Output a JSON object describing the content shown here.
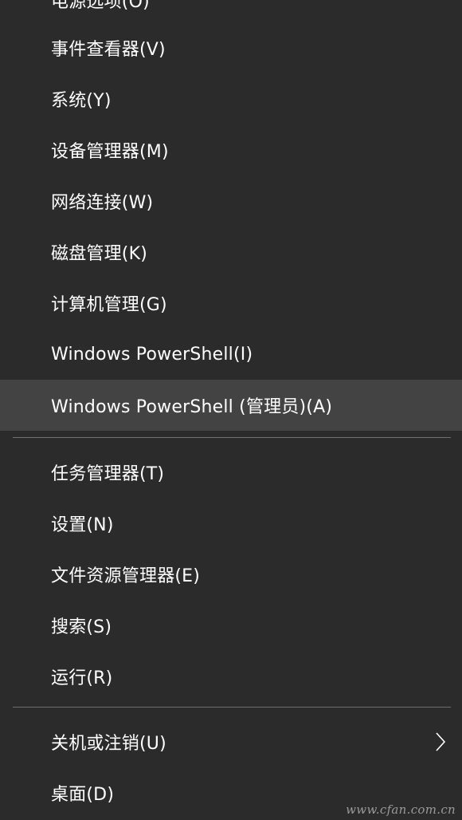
{
  "menu": {
    "items": [
      {
        "label": "电源选项(O)"
      },
      {
        "label": "事件查看器(V)"
      },
      {
        "label": "系统(Y)"
      },
      {
        "label": "设备管理器(M)"
      },
      {
        "label": "网络连接(W)"
      },
      {
        "label": "磁盘管理(K)"
      },
      {
        "label": "计算机管理(G)"
      },
      {
        "label": "Windows PowerShell(I)"
      },
      {
        "label": "Windows PowerShell (管理员)(A)",
        "highlighted": true
      },
      {
        "label": "任务管理器(T)"
      },
      {
        "label": "设置(N)"
      },
      {
        "label": "文件资源管理器(E)"
      },
      {
        "label": "搜索(S)"
      },
      {
        "label": "运行(R)"
      },
      {
        "label": "关机或注销(U)",
        "has_submenu": true,
        "submenu_icon": "chevron-right-icon"
      },
      {
        "label": "桌面(D)"
      }
    ]
  },
  "watermark": {
    "text": "www.cfan.com.cn"
  },
  "colors": {
    "background": "#2b2b2b",
    "highlight": "#434343",
    "separator": "#6e6e6e",
    "text": "#ffffff"
  }
}
